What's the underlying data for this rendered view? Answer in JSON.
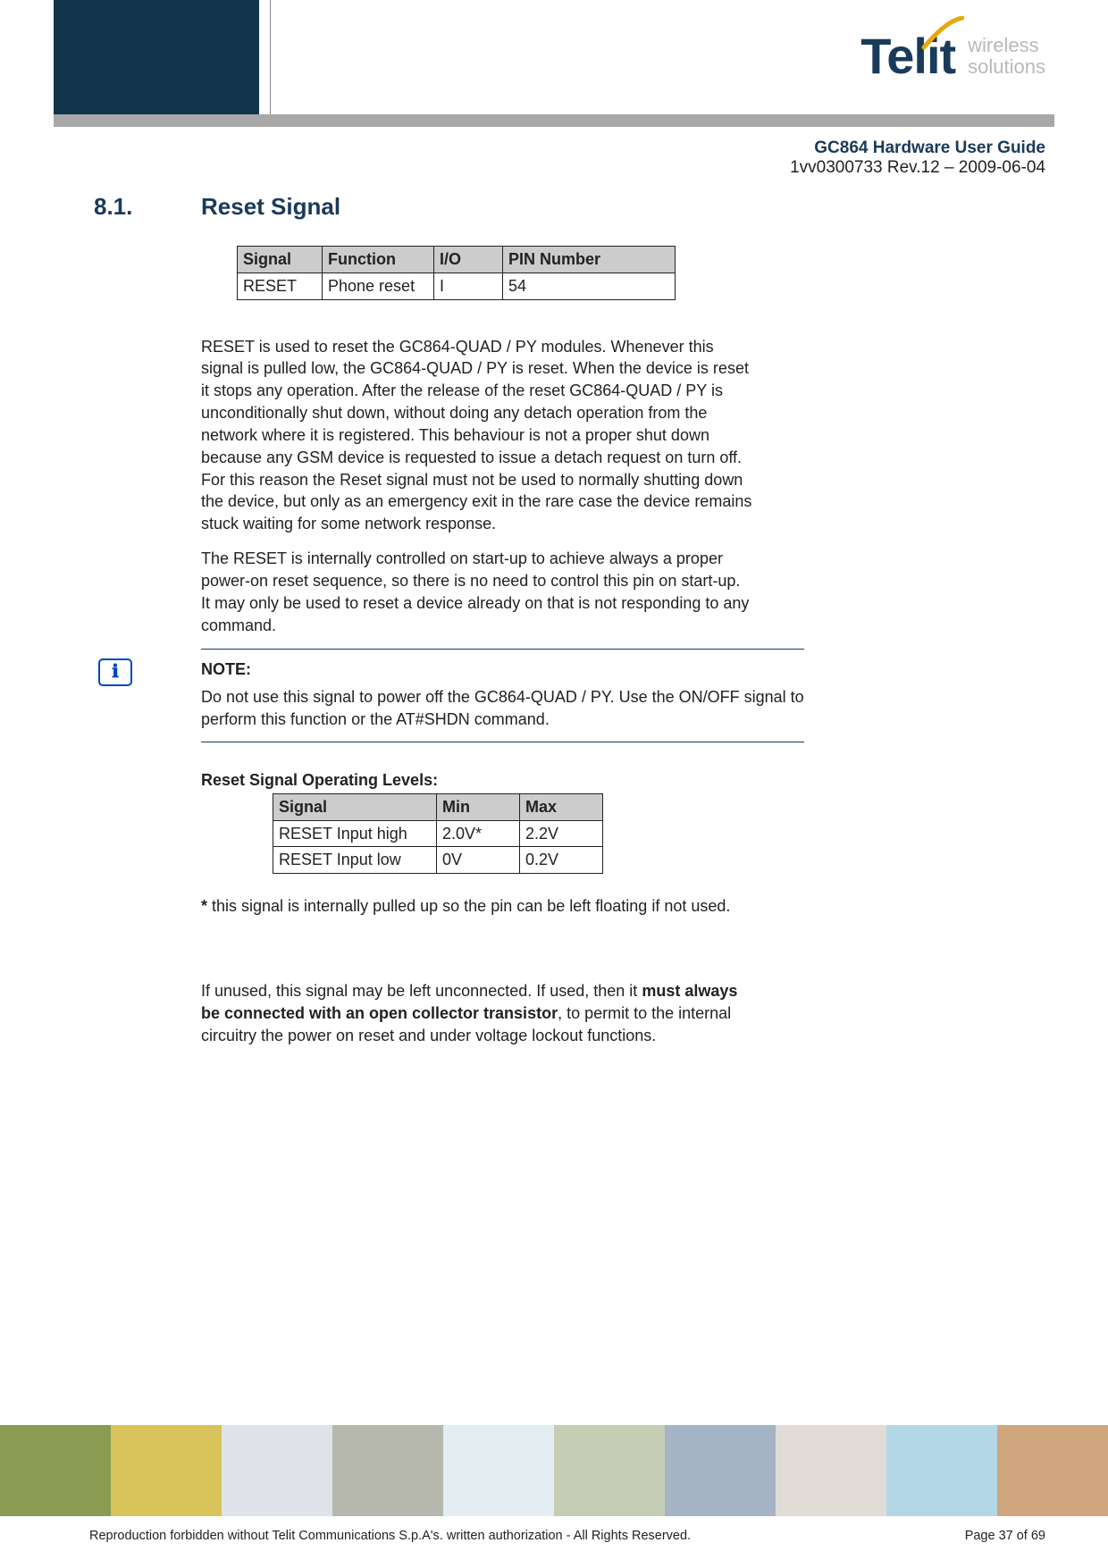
{
  "header": {
    "brand_name": "Telit",
    "brand_sub_line1": "wireless",
    "brand_sub_line2": "solutions",
    "doc_title": "GC864 Hardware User Guide",
    "doc_rev": "1vv0300733 Rev.12 – 2009-06-04"
  },
  "section": {
    "number": "8.1.",
    "title": "Reset Signal"
  },
  "signal_table": {
    "headers": [
      "Signal",
      "Function",
      "I/O",
      "PIN Number"
    ],
    "rows": [
      [
        "RESET",
        "Phone reset",
        "I",
        "54"
      ]
    ]
  },
  "paragraphs": {
    "p1": "RESET is used to reset the GC864-QUAD / PY modules. Whenever this signal is pulled low, the GC864-QUAD / PY is reset. When the device is reset it stops any operation. After the release of the reset GC864-QUAD / PY is unconditionally shut down, without doing any detach operation from the network where it is registered. This behaviour is not a proper shut down because any GSM device is requested to issue a detach request on turn off. For this reason the Reset signal must not be used to normally shutting down the device, but only as an emergency exit in the rare case the device remains stuck waiting for some network response.",
    "p2": "The RESET is internally controlled on start-up to achieve always a proper power-on reset sequence, so there is no need to control this pin on start-up. It may only be used to reset a device already on that is not responding to any command.",
    "note_label": "NOTE:",
    "note_body": "Do not use this signal to power off the GC864-QUAD / PY. Use the ON/OFF signal to perform this function or the AT#SHDN command.",
    "levels_title": "Reset Signal Operating Levels:",
    "footnote_marker": "*",
    "footnote_text": "  this signal is internally pulled up so the pin can be left floating if not used.",
    "p3_pre": "If unused, this signal may be left unconnected. If used, then it ",
    "p3_bold": "must always be connected with an open collector transistor",
    "p3_post": ", to permit to the internal circuitry the power on reset and under voltage lockout functions."
  },
  "levels_table": {
    "headers": [
      "Signal",
      "Min",
      "Max"
    ],
    "rows": [
      [
        "RESET Input high",
        "2.0V*",
        "2.2V"
      ],
      [
        "RESET Input low",
        "0V",
        "0.2V"
      ]
    ]
  },
  "footer": {
    "copyright": "Reproduction forbidden without Telit Communications S.p.A's. written authorization - All Rights Reserved.",
    "page": "Page 37 of 69"
  },
  "strip_colors": [
    "#8a9b52",
    "#d8c45a",
    "#dfe2e8",
    "#b7b8ad",
    "#e4eef2",
    "#c6cdb5",
    "#a4b4c5",
    "#e2dcd6",
    "#b3d7e7",
    "#cfa67d"
  ]
}
